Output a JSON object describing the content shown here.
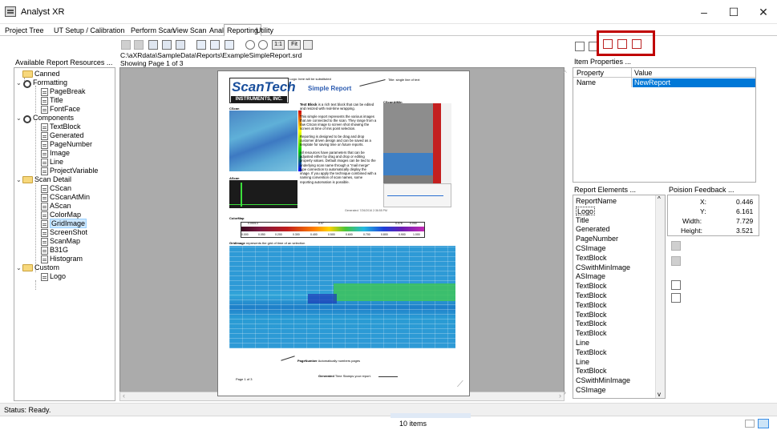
{
  "window": {
    "title": "Analyst XR",
    "minimize": "–",
    "maximize": "☐",
    "close": "✕"
  },
  "tabs": [
    {
      "label": "Project Tree"
    },
    {
      "label": "UT Setup / Calibration"
    },
    {
      "label": "Perform Scan"
    },
    {
      "label": "View Scan"
    },
    {
      "label": "Analysis"
    },
    {
      "label": "Reporting"
    },
    {
      "label": "Utility"
    }
  ],
  "left": {
    "heading": "Available Report Resources ...",
    "tree": [
      {
        "label": "Canned",
        "icon": "folder-icon"
      },
      {
        "label": "Formatting",
        "icon": "gear-icon"
      },
      {
        "label": "PageBreak",
        "icon": "page-icon"
      },
      {
        "label": "Title",
        "icon": "page-icon"
      },
      {
        "label": "FontFace",
        "icon": "page-icon"
      },
      {
        "label": "Components",
        "icon": "gear-icon"
      },
      {
        "label": "TextBlock",
        "icon": "page-icon"
      },
      {
        "label": "Generated",
        "icon": "page-icon"
      },
      {
        "label": "PageNumber",
        "icon": "page-icon"
      },
      {
        "label": "Image",
        "icon": "page-icon"
      },
      {
        "label": "Line",
        "icon": "page-icon"
      },
      {
        "label": "ProjectVariable",
        "icon": "page-icon"
      },
      {
        "label": "Scan Detail",
        "icon": "folder-icon"
      },
      {
        "label": "CScan",
        "icon": "page-icon"
      },
      {
        "label": "CScanAtMin",
        "icon": "page-icon"
      },
      {
        "label": "AScan",
        "icon": "page-icon"
      },
      {
        "label": "ColorMap",
        "icon": "page-icon"
      },
      {
        "label": "GridImage",
        "icon": "page-icon"
      },
      {
        "label": "ScreenShot",
        "icon": "page-icon"
      },
      {
        "label": "ScanMap",
        "icon": "page-icon"
      },
      {
        "label": "B31G",
        "icon": "page-icon"
      },
      {
        "label": "Histogram",
        "icon": "page-icon"
      },
      {
        "label": "Custom",
        "icon": "folder-icon"
      },
      {
        "label": "Logo",
        "icon": "page-icon"
      }
    ]
  },
  "center": {
    "path": "C:\\aXRdata\\SampleData\\Reports\\ExampleSimpleReport.srd",
    "showing": "Showing Page 1 of 3",
    "toolbar": {
      "btn_11": "1:1",
      "btn_fit": "Fit"
    },
    "report": {
      "logo_line1": "ScanTech",
      "logo_line2": "INSTRUMENTS, INC.",
      "logo_note": "Logo: here will be substituted",
      "title": "Simple Report",
      "title_note": "Title: single line of text",
      "cscan_label": "CScan",
      "cscanatmin_label": "CScanAtMin",
      "ascan_label": "AScan",
      "textblock_heading": "Text Block",
      "textblock_p1": "is a rich text block that can be edited and resized with real-time wrapping.",
      "textblock_p2": "This simple report represents the various images that are connected to the scan. They range from a raw CScan image to screen shot showing the screen at time of mis point selection.",
      "textblock_p3": "Reporting is designed to be drag and drop customer driven design and can be saved as a template for saving time on future reports.",
      "textblock_p4": "All resources have parameters that can be adjusted either by drag and drop or editing property values. Default images can be tied to the underlying scan name through a \"mail merge\" type connection to automatically display the image. If you apply the technique combined with a naming convention of scan names, some reporting automation is possible.",
      "generated_small": "Generated: 7/26/2016 2:36:55 PM",
      "colormap_label": "ColorMap",
      "colormap_vals": [
        "0.000",
        "0.050",
        "0.200",
        "0.300",
        "0.400",
        "0.500",
        "0.600",
        "0.700",
        "0.800",
        "0.900",
        "1.000"
      ],
      "colormap_top": [
        "0.00013",
        "0.07",
        "0.078",
        "0.040"
      ],
      "grid_label": "GridImage",
      "grid_note": "represents the grid of time of an selection",
      "pagenumber_label": "PageNumber",
      "pagenumber_note": "Automatically numbers pages",
      "page_of": "Page 1 of 3",
      "generated_label": "Generated",
      "generated_note": "Time Stamps your report."
    }
  },
  "right": {
    "item_properties_heading": "Item Properties ...",
    "prop_headers": [
      "Property",
      "Value"
    ],
    "prop_rows": [
      {
        "property": "Name",
        "value": "NewReport"
      }
    ],
    "report_elements_heading": "Report Elements ...",
    "report_elements": [
      "ReportName",
      "Logo",
      "Title",
      "Generated",
      "PageNumber",
      "CSImage",
      "TextBlock",
      "CSwithMinImage",
      "ASImage",
      "TextBlock",
      "TextBlock",
      "TextBlock",
      "TextBlock",
      "TextBlock",
      "TextBlock",
      "Line",
      "TextBlock",
      "Line",
      "TextBlock",
      "CSwithMinImage",
      "CSImage"
    ],
    "position_heading": "Poision Feedback ...",
    "position": [
      {
        "label": "X:",
        "value": "0.446"
      },
      {
        "label": "Y:",
        "value": "6.161"
      },
      {
        "label": "Width:",
        "value": "7.729"
      },
      {
        "label": "Height:",
        "value": "3.521"
      }
    ],
    "highlight_color": "#c00000"
  },
  "status": {
    "text": "Status: Ready."
  },
  "taskbar": {
    "items": "10 items"
  }
}
